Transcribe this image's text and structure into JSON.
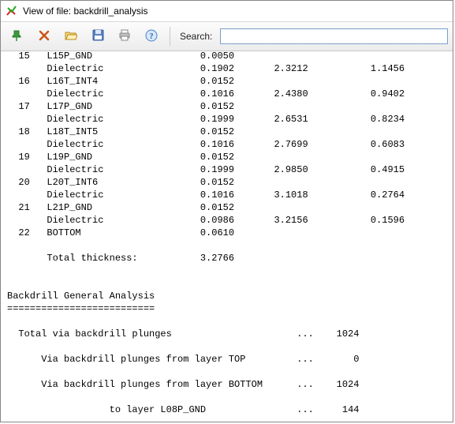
{
  "window": {
    "title": "View of file: backdrill_analysis"
  },
  "toolbar": {
    "search_label": "Search:",
    "search_value": ""
  },
  "report": {
    "lines": [
      "  15   L15P_GND                   0.0050",
      "       Dielectric                 0.1902       2.3212           1.1456",
      "  16   L16T_INT4                  0.0152",
      "       Dielectric                 0.1016       2.4380           0.9402",
      "  17   L17P_GND                   0.0152",
      "       Dielectric                 0.1999       2.6531           0.8234",
      "  18   L18T_INT5                  0.0152",
      "       Dielectric                 0.1016       2.7699           0.6083",
      "  19   L19P_GND                   0.0152",
      "       Dielectric                 0.1999       2.9850           0.4915",
      "  20   L20T_INT6                  0.0152",
      "       Dielectric                 0.1016       3.1018           0.2764",
      "  21   L21P_GND                   0.0152",
      "       Dielectric                 0.0986       3.2156           0.1596",
      "  22   BOTTOM                     0.0610",
      "",
      "       Total thickness:           3.2766",
      "",
      "",
      "Backdrill General Analysis",
      "==========================",
      "",
      "  Total via backdrill plunges                      ...    1024",
      "",
      "      Via backdrill plunges from layer TOP         ...       0",
      "",
      "      Via backdrill plunges from layer BOTTOM      ...    1024",
      "",
      "                  to layer L08P_GND                ...     144"
    ]
  },
  "icons": {
    "pin": "pin-icon",
    "delete": "delete-icon",
    "open": "open-folder-icon",
    "save": "save-icon",
    "print": "print-icon",
    "help": "help-icon"
  }
}
